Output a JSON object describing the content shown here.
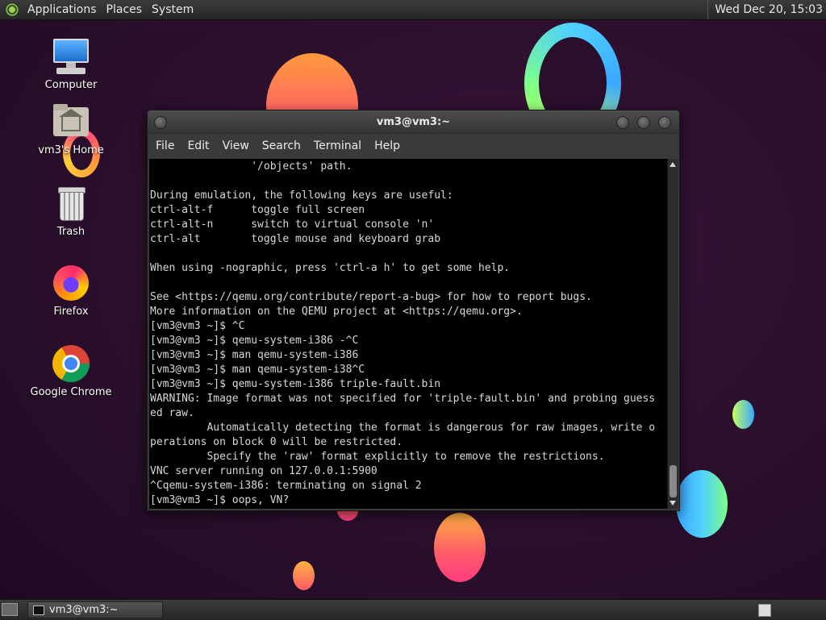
{
  "top_panel": {
    "menus": [
      "Applications",
      "Places",
      "System"
    ],
    "clock": "Wed Dec 20, 15:03"
  },
  "desktop_icons": [
    {
      "label": "Computer",
      "icon": "computer-icon"
    },
    {
      "label": "vm3's Home",
      "icon": "home-folder-icon"
    },
    {
      "label": "Trash",
      "icon": "trash-icon"
    },
    {
      "label": "Firefox",
      "icon": "firefox-icon"
    },
    {
      "label": "Google Chrome",
      "icon": "chrome-icon"
    }
  ],
  "terminal": {
    "title": "vm3@vm3:~",
    "menu": [
      "File",
      "Edit",
      "View",
      "Search",
      "Terminal",
      "Help"
    ],
    "lines": [
      "                '/objects' path.",
      "",
      "During emulation, the following keys are useful:",
      "ctrl-alt-f      toggle full screen",
      "ctrl-alt-n      switch to virtual console 'n'",
      "ctrl-alt        toggle mouse and keyboard grab",
      "",
      "When using -nographic, press 'ctrl-a h' to get some help.",
      "",
      "See <https://qemu.org/contribute/report-a-bug> for how to report bugs.",
      "More information on the QEMU project at <https://qemu.org>.",
      "[vm3@vm3 ~]$ ^C",
      "[vm3@vm3 ~]$ qemu-system-i386 -^C",
      "[vm3@vm3 ~]$ man qemu-system-i386",
      "[vm3@vm3 ~]$ man qemu-system-i38^C",
      "[vm3@vm3 ~]$ qemu-system-i386 triple-fault.bin",
      "WARNING: Image format was not specified for 'triple-fault.bin' and probing guess",
      "ed raw.",
      "         Automatically detecting the format is dangerous for raw images, write o",
      "perations on block 0 will be restricted.",
      "         Specify the 'raw' format explicitly to remove the restrictions.",
      "VNC server running on 127.0.0.1:5900",
      "^Cqemu-system-i386: terminating on signal 2",
      "[vm3@vm3 ~]$ oops, VN?"
    ]
  },
  "taskbar": {
    "task_label": "vm3@vm3:~"
  }
}
